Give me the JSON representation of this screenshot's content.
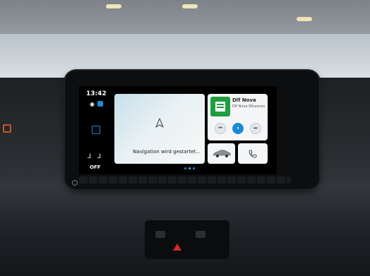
{
  "status_bar": {
    "time": "13:42",
    "climate_label": "OFF",
    "icons": [
      "connectivity-icon",
      "home-square-icon",
      "seat-heater-icon"
    ]
  },
  "navigation": {
    "status_text": "Navigation wird gestartet...",
    "icon": "navigation-arrow-icon"
  },
  "now_playing": {
    "station": "Dlf Nova",
    "subtitle": "Dlf Nova Wissensn...",
    "controls": [
      "previous-icon",
      "pause-icon",
      "next-icon"
    ]
  },
  "shortcuts": [
    "car-icon",
    "phone-icon"
  ],
  "page_indicator": {
    "count": 3,
    "active": 1
  },
  "colors": {
    "accent": "#1b8ad6",
    "art": "#1f9e3f",
    "panel": "#f4f5f7"
  }
}
